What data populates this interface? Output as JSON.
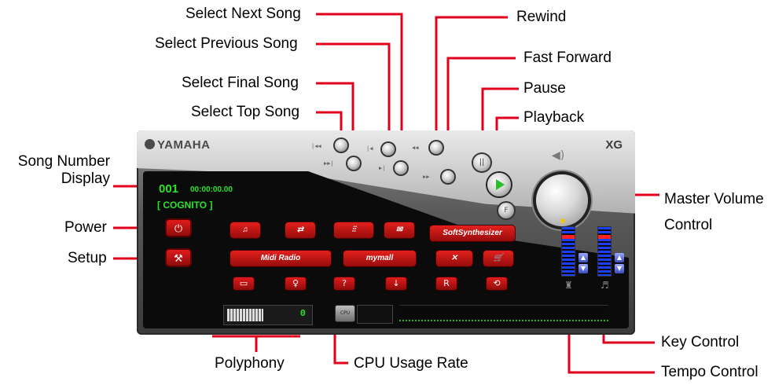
{
  "callouts": {
    "select_next_song": "Select Next Song",
    "select_previous_song": "Select Previous Song",
    "select_final_song": "Select Final Song",
    "select_top_song": "Select Top Song",
    "rewind": "Rewind",
    "fast_forward": "Fast Forward",
    "pause": "Pause",
    "playback": "Playback",
    "song_number_display": "Song Number\nDisplay",
    "power": "Power",
    "setup": "Setup",
    "master_volume_control": "Master Volume\nControl",
    "key_control": "Key Control",
    "tempo_control": "Tempo Control",
    "polyphony": "Polyphony",
    "cpu_usage_rate": "CPU Usage Rate"
  },
  "player": {
    "brand": "YAMAHA",
    "format_logo": "XG",
    "song_number": "001",
    "elapsed_time": "00:00:00.00",
    "song_title": "[ COGNITO ]",
    "polyphony_value": "0",
    "cpu_chip_label": "CPU",
    "app_buttons": [
      "SoftSynthesizer",
      "Midi Radio",
      "mymall"
    ],
    "colors": {
      "accent_red": "#e3211c",
      "lcd_green": "#29e329",
      "meter_blue": "#1d3fff",
      "leader_red": "#e0001b"
    },
    "icons": {
      "power": "power-icon",
      "setup": "wrench-icon",
      "volume": "speaker-icon"
    }
  }
}
